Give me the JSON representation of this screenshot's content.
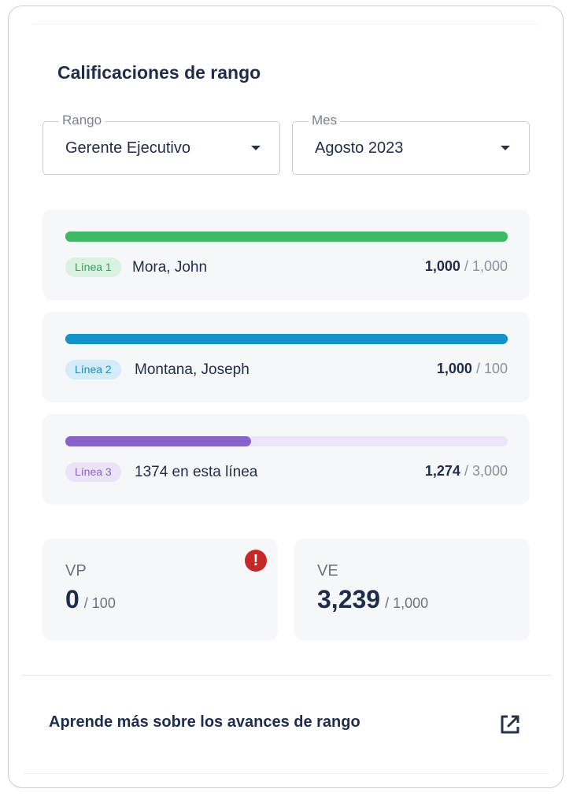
{
  "card": {
    "title": "Calificaciones de rango"
  },
  "filters": {
    "rango_label": "Rango",
    "rango_value": "Gerente Ejecutivo",
    "mes_label": "Mes",
    "mes_value": "Agosto 2023"
  },
  "lines": [
    {
      "badge": "Línea 1",
      "name": "Mora, John",
      "current": "1,000",
      "sep": " / ",
      "target": "1,000",
      "progress": 1.0,
      "color": "#3dba63",
      "track": "#3dba63",
      "badge_bg": "#d9f2e1",
      "badge_fg": "#3a9a58"
    },
    {
      "badge": "Línea 2",
      "name": "Montana, Joseph",
      "current": "1,000",
      "sep": " / ",
      "target": "100",
      "progress": 1.0,
      "color": "#1493c8",
      "track": "#1493c8",
      "badge_bg": "#d4ecf8",
      "badge_fg": "#1d8cc0"
    },
    {
      "badge": "Línea 3",
      "name": "1374 en esta línea",
      "current": "1,274",
      "sep": " / ",
      "target": "3,000",
      "progress": 0.42,
      "color": "#8a62cc",
      "track": "#ece6f8",
      "badge_bg": "#ebe3f8",
      "badge_fg": "#8a62cc"
    }
  ],
  "metrics": {
    "vp": {
      "label": "VP",
      "value": "0",
      "of": "/ 100",
      "alert": "!"
    },
    "ve": {
      "label": "VE",
      "value": "3,239",
      "of": "/ 1,000"
    }
  },
  "footer": {
    "link_text": "Aprende más sobre los avances de rango",
    "icon": "external-link-icon"
  }
}
